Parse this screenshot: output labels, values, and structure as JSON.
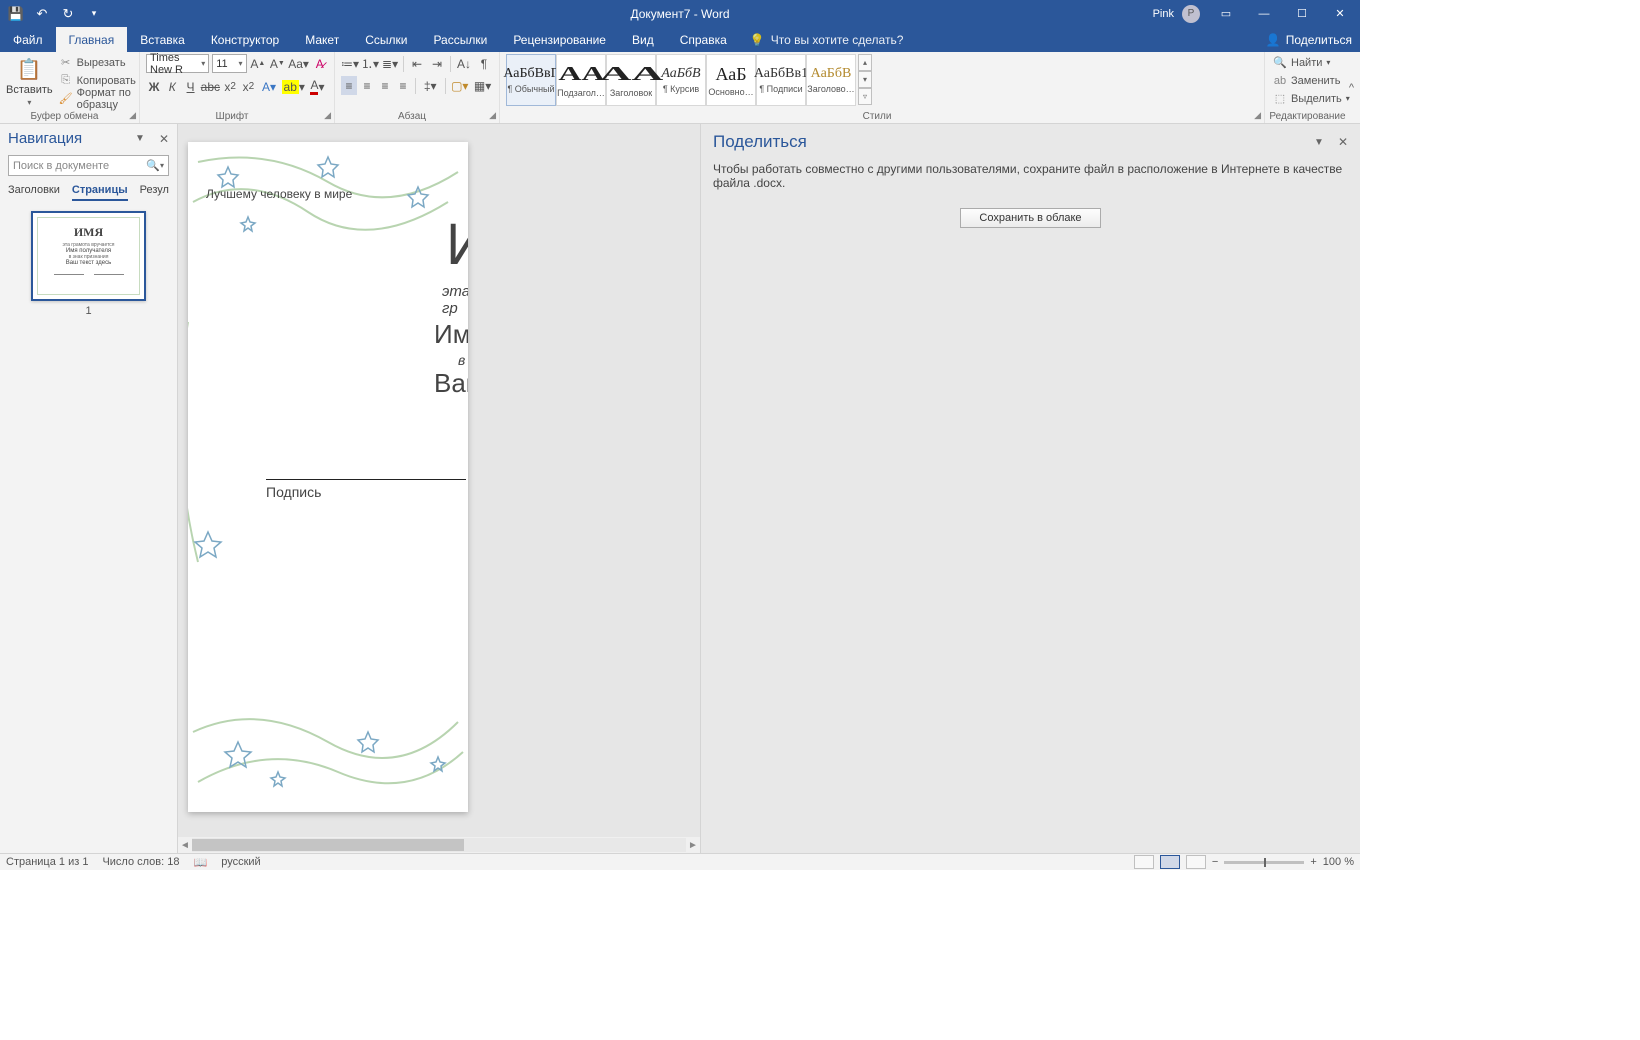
{
  "titlebar": {
    "doc_title": "Документ7 - Word",
    "user_name": "Pink",
    "user_initial": "P"
  },
  "tabs": {
    "file": "Файл",
    "home": "Главная",
    "insert": "Вставка",
    "design": "Конструктор",
    "layout": "Макет",
    "references": "Ссылки",
    "mailings": "Рассылки",
    "review": "Рецензирование",
    "view": "Вид",
    "help": "Справка",
    "tell_me": "Что вы хотите сделать?",
    "share": "Поделиться"
  },
  "ribbon": {
    "clipboard": {
      "paste": "Вставить",
      "cut": "Вырезать",
      "copy": "Копировать",
      "format_painter": "Формат по образцу",
      "label": "Буфер обмена"
    },
    "font": {
      "name": "Times New R",
      "size": "11",
      "label": "Шрифт",
      "bold": "Ж",
      "italic": "К",
      "underline": "Ч"
    },
    "paragraph": {
      "label": "Абзац"
    },
    "styles": {
      "label": "Стили",
      "items": [
        {
          "prev": "АаБбВвГ",
          "lbl": "¶ Обычный",
          "sel": true,
          "color": "#222"
        },
        {
          "prev": "АА",
          "lbl": "Подзагол…",
          "color": "#222",
          "big": true
        },
        {
          "prev": "АА",
          "lbl": "Заголовок",
          "color": "#222",
          "big": true,
          "wide": true
        },
        {
          "prev": "АаБбВ",
          "lbl": "¶ Курсив",
          "color": "#333",
          "it": true
        },
        {
          "prev": "АаБ",
          "lbl": "Основно…",
          "color": "#222",
          "big2": true
        },
        {
          "prev": "АаБбВв1",
          "lbl": "¶ Подписи",
          "color": "#333"
        },
        {
          "prev": "АаБбВ",
          "lbl": "Заголово…",
          "color": "#b38a2e"
        }
      ]
    },
    "editing": {
      "find": "Найти",
      "replace": "Заменить",
      "select": "Выделить",
      "label": "Редактирование"
    }
  },
  "nav": {
    "title": "Навигация",
    "search_placeholder": "Поиск в документе",
    "tabs": {
      "headings": "Заголовки",
      "pages": "Страницы",
      "results": "Результаты"
    },
    "page_num": "1",
    "thumb": {
      "title": "ИМЯ"
    }
  },
  "document": {
    "line1": "Лучшему человеку в мире",
    "big1": "И",
    "line2": "эта гр",
    "line3": "Имя",
    "line4": "в",
    "line5": "Ваш",
    "sig": "Подпись"
  },
  "share_pane": {
    "title": "Поделиться",
    "msg": "Чтобы работать совместно с другими пользователями, сохраните файл в расположение в Интернете в качестве файла .docx.",
    "button": "Сохранить в облаке"
  },
  "status": {
    "page": "Страница 1 из 1",
    "words": "Число слов: 18",
    "lang": "русский",
    "zoom": "100 %"
  }
}
